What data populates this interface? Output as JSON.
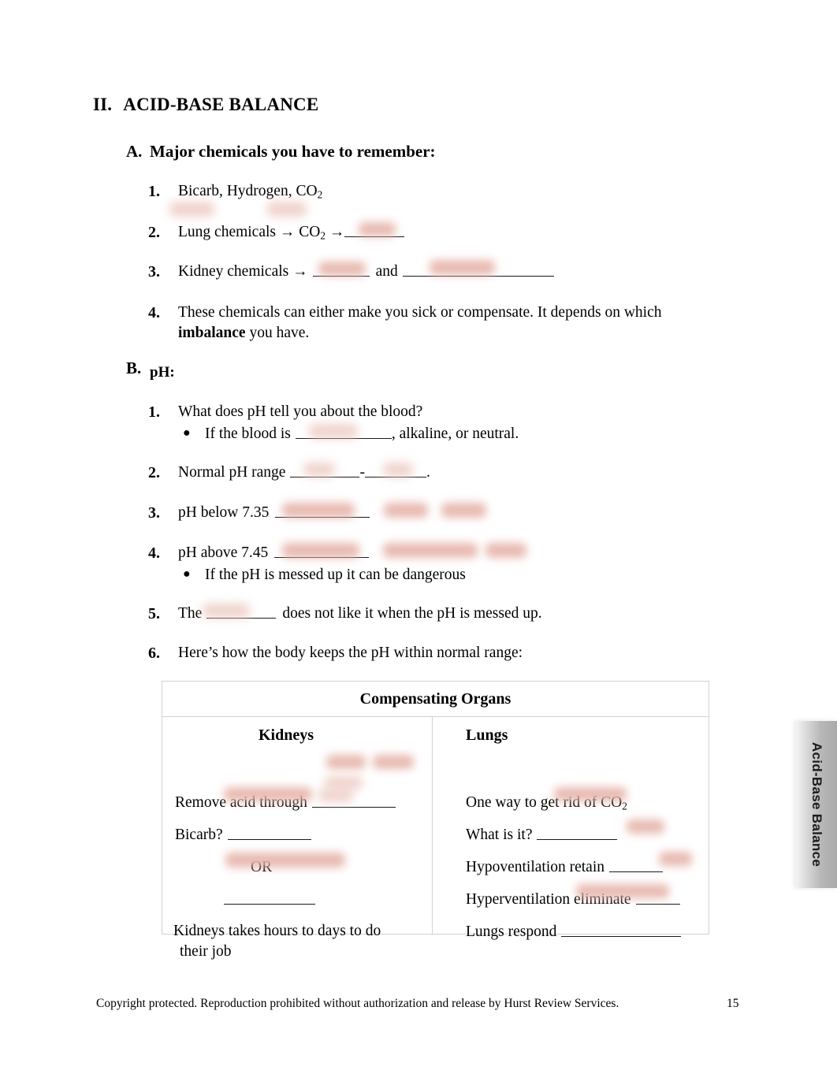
{
  "section": {
    "numeral": "II.",
    "title": "ACID-BASE BALANCE"
  },
  "subsection_a": {
    "letter": "A.",
    "title": "Major chemicals you have to remember:",
    "items": [
      {
        "num": "1.",
        "text_before": "Bicarb, Hydrogen, CO",
        "sub": "2"
      },
      {
        "num": "2.",
        "text_before": "Lung chemicals → CO",
        "sub": "2",
        "text_after": " →"
      },
      {
        "num": "3.",
        "text_before": "Kidney chemicals →",
        "mid": "and"
      },
      {
        "num": "4.",
        "text_line1": "These chemicals can either make you sick or compensate. It depends on which",
        "bold_word": "imbalance",
        "text_line2_after": " you have."
      }
    ]
  },
  "subsection_b": {
    "letter": "B.",
    "title": "pH:",
    "items": [
      {
        "num": "1.",
        "text": "What does pH tell you about the blood?"
      },
      {
        "num": "2.",
        "text_before": "Normal pH range",
        "sep": "-",
        "text_after": "."
      },
      {
        "num": "3.",
        "text_before": "pH below 7.35"
      },
      {
        "num": "4.",
        "text_before": "pH above 7.45"
      },
      {
        "num": "5.",
        "text_before": "The",
        "text_after": "does not like it when the pH is messed up."
      },
      {
        "num": "6.",
        "text": "Here’s how the body keeps the pH within normal range:"
      }
    ],
    "bullets": [
      {
        "after_item": "1.",
        "text_before": "If the blood is",
        "text_after": ", alkaline, or neutral."
      },
      {
        "after_item": "4.",
        "text": "If the pH is messed up it can be dangerous"
      }
    ]
  },
  "table": {
    "title": "Compensating Organs",
    "columns": [
      {
        "header": "Kidneys",
        "lines": [
          {
            "text": "Remove acid through"
          },
          {
            "text": "Bicarb?"
          },
          {
            "text": "OR"
          },
          {
            "text": ""
          },
          {
            "text": "Kidneys takes hours to days to do"
          },
          {
            "text": "their job"
          }
        ]
      },
      {
        "header": "Lungs",
        "lines": [
          {
            "text_before": "One way to get rid of CO",
            "sub": "2"
          },
          {
            "text": "What is it?"
          },
          {
            "text": "Hypoventilation retain"
          },
          {
            "text": "Hyperventilation eliminate"
          },
          {
            "text": "Lungs respond"
          }
        ]
      }
    ]
  },
  "side_tab": {
    "label": "Acid-Base Balance"
  },
  "footer": {
    "copyright": "Copyright protected. Reproduction prohibited without authorization and release by Hurst Review Services.",
    "page_number": "15"
  },
  "colors": {
    "redaction": "#e6b4aa",
    "table_border": "#d2d2d2",
    "side_tab": "#b8b8b8",
    "text": "#000000"
  }
}
